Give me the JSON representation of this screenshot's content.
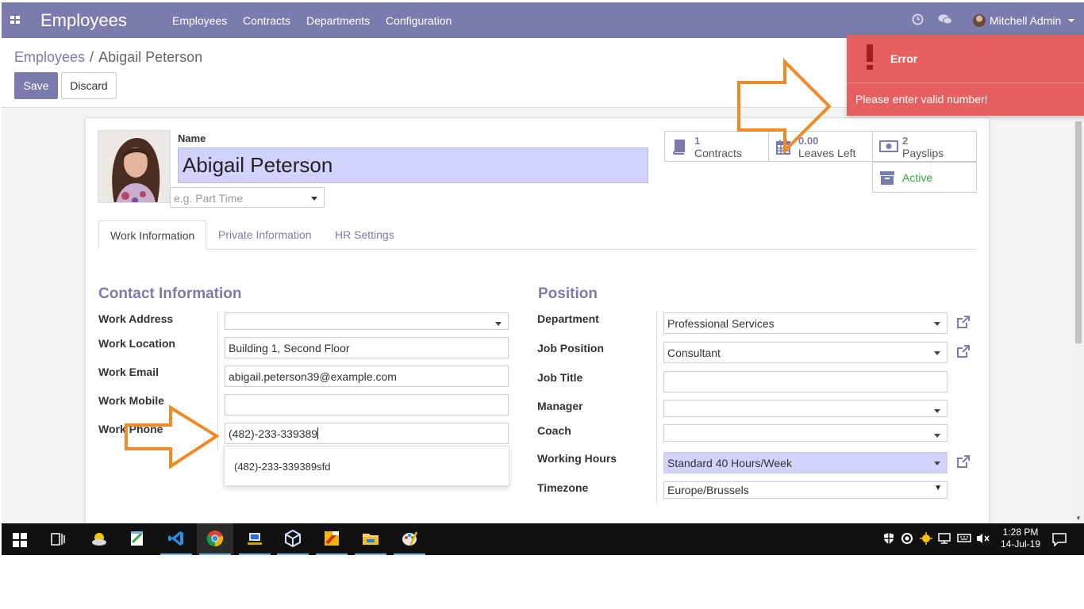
{
  "navbar": {
    "brand": "Employees",
    "menu": [
      "Employees",
      "Contracts",
      "Departments",
      "Configuration"
    ],
    "user": "Mitchell Admin",
    "icons": [
      "apps-grid-icon",
      "clock-icon",
      "chat-icon",
      "avatar"
    ],
    "color": "#7c7bad"
  },
  "breadcrumb": {
    "parent": "Employees",
    "separator": "/",
    "current": "Abigail Peterson"
  },
  "buttons": {
    "save": "Save",
    "discard": "Discard"
  },
  "employee": {
    "name_label": "Name",
    "name": "Abigail Peterson",
    "tag_placeholder": "e.g. Part Time"
  },
  "smart_buttons": {
    "contracts": {
      "value": "1",
      "label": "Contracts",
      "icon": "book-icon"
    },
    "leaves": {
      "value": "0.00",
      "label": "Leaves Left",
      "icon": "calendar-icon"
    },
    "payslips": {
      "value": "2",
      "label": "Payslips",
      "icon": "money-icon"
    },
    "active": {
      "label": "Active",
      "icon": "archive-icon"
    }
  },
  "tabs": [
    "Work Information",
    "Private Information",
    "HR Settings"
  ],
  "contact": {
    "title": "Contact Information",
    "labels": {
      "work_address": "Work Address",
      "work_location": "Work Location",
      "work_email": "Work Email",
      "work_mobile": "Work Mobile",
      "work_phone": "Work Phone"
    },
    "values": {
      "work_address": "",
      "work_location": "Building 1, Second Floor",
      "work_email": "abigail.peterson39@example.com",
      "work_mobile": "",
      "work_phone": "(482)-233-339389"
    },
    "autocomplete_suggestion": "(482)-233-339389sfd"
  },
  "position": {
    "title": "Position",
    "labels": {
      "department": "Department",
      "job_position": "Job Position",
      "job_title": "Job Title",
      "manager": "Manager",
      "coach": "Coach",
      "working_hours": "Working Hours",
      "timezone": "Timezone"
    },
    "values": {
      "department": "Professional Services",
      "job_position": "Consultant",
      "job_title": "",
      "manager": "",
      "coach": "",
      "working_hours": "Standard 40 Hours/Week",
      "timezone": "Europe/Brussels"
    }
  },
  "notification": {
    "title": "Error",
    "message": "Please enter valid number!",
    "color": "#e66062"
  },
  "taskbar": {
    "time": "1:28 PM",
    "date": "14-Jul-19"
  }
}
